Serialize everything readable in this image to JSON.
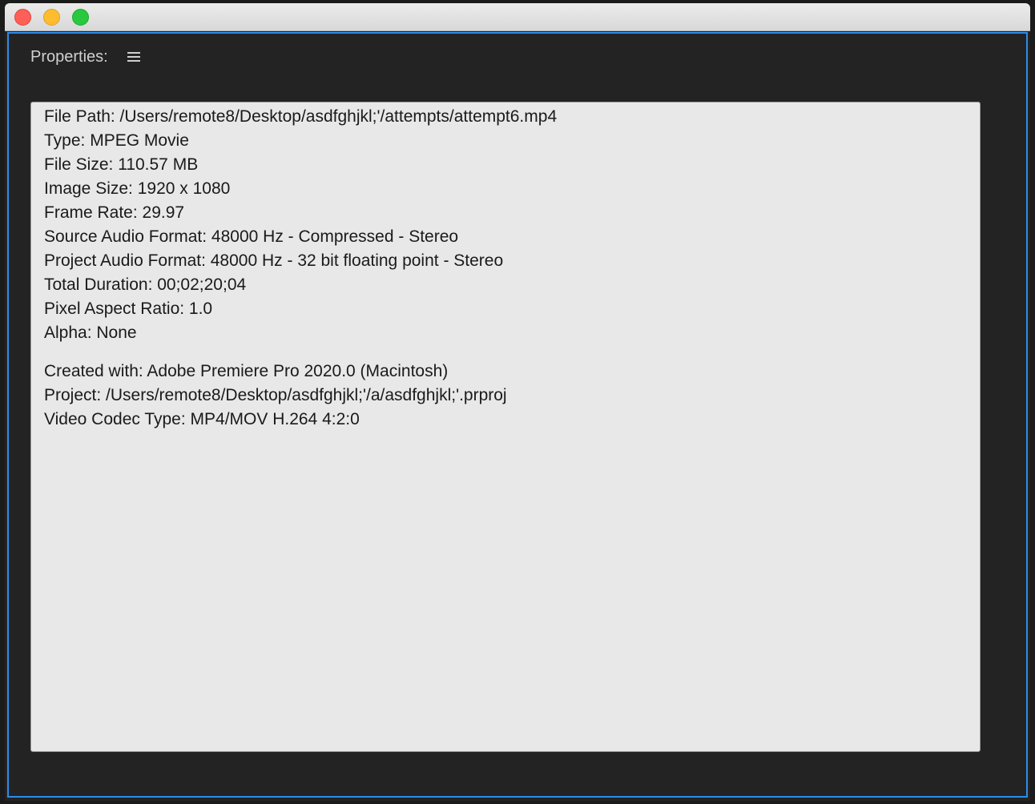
{
  "panel": {
    "title": "Properties:",
    "menu_icon": "hamburger-menu-icon"
  },
  "properties": {
    "group1": [
      "File Path: /Users/remote8/Desktop/asdfghjkl;'/attempts/attempt6.mp4",
      "Type: MPEG Movie",
      "File Size: 110.57 MB",
      "Image Size: 1920 x 1080",
      "Frame Rate: 29.97",
      "Source Audio Format: 48000 Hz - Compressed - Stereo",
      "Project Audio Format: 48000 Hz - 32 bit floating point - Stereo",
      "Total Duration: 00;02;20;04",
      "Pixel Aspect Ratio: 1.0",
      "Alpha: None"
    ],
    "group2": [
      "Created with: Adobe Premiere Pro 2020.0 (Macintosh)",
      "Project: /Users/remote8/Desktop/asdfghjkl;'/a/asdfghjkl;'.prproj",
      "Video Codec Type: MP4/MOV H.264 4:2:0"
    ]
  },
  "colors": {
    "panel_focus_border": "#2d8ceb",
    "panel_background": "#232323",
    "content_background": "#e8e8e8"
  }
}
